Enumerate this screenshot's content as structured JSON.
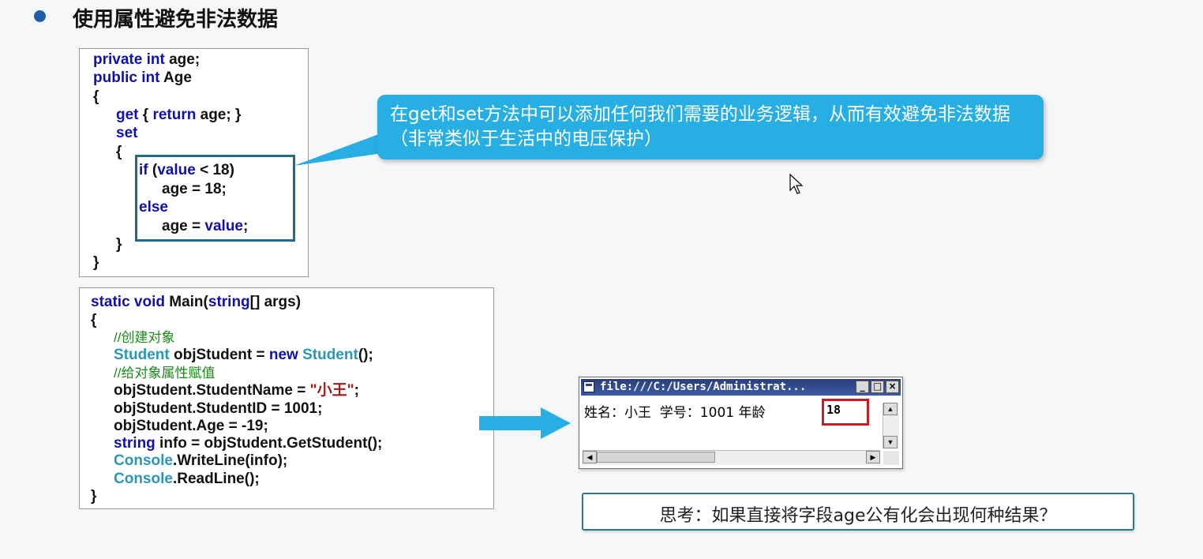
{
  "slide": {
    "title": "使用属性避免非法数据"
  },
  "code1": {
    "lines": [
      [
        "private",
        " ",
        "int",
        " age;"
      ],
      [
        "public",
        " ",
        "int",
        " Age"
      ],
      "{",
      "get { return age; }",
      "set",
      "{",
      "if (value < 18)",
      "age = 18;",
      "else",
      "age = value;",
      "}",
      "}"
    ],
    "l1_kw": "private int",
    "l1_rest": " age;",
    "l2_kw": "public int",
    "l2_rest": " Age",
    "l3": "{",
    "l4_a": "get",
    "l4_b": " { ",
    "l4_c": "return",
    "l4_d": " age; }",
    "l5": "set",
    "l6": "{",
    "l7_a": "if",
    "l7_b": " (",
    "l7_c": "value",
    "l7_d": " < 18)",
    "l8": "age = 18;",
    "l9": "else",
    "l10_a": "age = ",
    "l10_b": "value",
    "l10_c": ";",
    "l11": "}",
    "l12": "}"
  },
  "callout": {
    "text": "在get和set方法中可以添加任何我们需要的业务逻辑，从而有效避免非法数据（非常类似于生活中的电压保护）"
  },
  "code2": {
    "m1_a": "static void",
    "m1_b": " Main(",
    "m1_c": "string",
    "m1_d": "[] args)",
    "m2": "{",
    "m3": "//创建对象",
    "m4_a": "Student",
    "m4_b": " objStudent = ",
    "m4_c": "new",
    "m4_d": " ",
    "m4_e": "Student",
    "m4_f": "();",
    "m5": "//给对象属性赋值",
    "m6_a": "objStudent.StudentName = ",
    "m6_b": "\"小王\"",
    "m6_c": ";",
    "m7": "objStudent.StudentID = 1001;",
    "m8": "objStudent.Age = -19;",
    "m9_a": "string",
    "m9_b": " info = objStudent.GetStudent();",
    "m10_a": "Console",
    "m10_b": ".WriteLine(info);",
    "m11_a": "Console",
    "m11_b": ".ReadLine();",
    "m12": "}"
  },
  "console": {
    "title": "file:///C:/Users/Administrat...",
    "minimize": "_",
    "maximize": "□",
    "close": "×",
    "output": "姓名：小王  学号：1001 年龄",
    "age_value": "18",
    "scroll_up": "▲",
    "scroll_down": "▼",
    "scroll_left": "◀",
    "scroll_right": "▶"
  },
  "think": {
    "text": "思考：如果直接将字段age公有化会出现何种结果？"
  },
  "colors": {
    "callout": "#27aee3",
    "keyword": "#1010b0",
    "type": "#2a96b8",
    "comment": "#1a8a1a",
    "highlight_border": "#c81e1e"
  },
  "icons": {
    "bullet": "bullet-icon",
    "cursor": "mouse-cursor-icon",
    "arrow": "right-arrow-icon"
  }
}
